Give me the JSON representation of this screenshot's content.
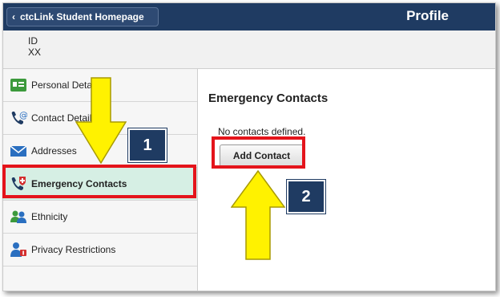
{
  "header": {
    "back_label": "ctcLink Student Homepage",
    "back_chevron": "‹",
    "title": "Profile"
  },
  "id_bar": {
    "label": "ID",
    "value": "XX"
  },
  "sidebar": {
    "items": [
      {
        "label": "Personal Details",
        "icon": "personal-details-icon"
      },
      {
        "label": "Contact Details",
        "icon": "contact-details-icon"
      },
      {
        "label": "Addresses",
        "icon": "envelope-icon"
      },
      {
        "label": "Emergency Contacts",
        "icon": "emergency-phone-icon",
        "active": true
      },
      {
        "label": "Ethnicity",
        "icon": "people-icon"
      },
      {
        "label": "Privacy Restrictions",
        "icon": "privacy-icon"
      }
    ]
  },
  "main": {
    "title": "Emergency Contacts",
    "empty_text": "No contacts defined.",
    "add_button": "Add Contact"
  },
  "annotations": {
    "step1": "1",
    "step2": "2",
    "arrow_color": "#fff200",
    "highlight_color": "#e4141b",
    "badge_color": "#1f3b62"
  }
}
